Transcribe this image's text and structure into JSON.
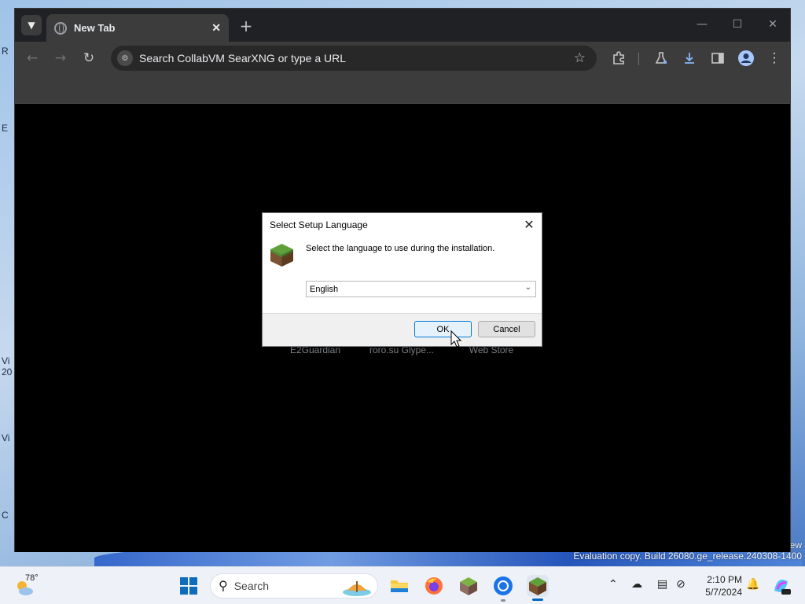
{
  "desktop": {
    "fragments": [
      "R",
      "E",
      "Vi",
      "20",
      "Vi",
      "C"
    ],
    "eval_line1": "ew",
    "eval_text": "Evaluation copy. Build 26080.ge_release.240308-1400"
  },
  "browser": {
    "tab_title": "New Tab",
    "omnibox_placeholder": "Search CollabVM SearXNG or type a URL",
    "shortcuts": [
      "E2Guardian",
      "roro.su Glype...",
      "Web Store"
    ]
  },
  "dialog": {
    "title": "Select Setup Language",
    "message": "Select the language to use during the installation.",
    "selected_language": "English",
    "ok_label": "OK",
    "cancel_label": "Cancel"
  },
  "taskbar": {
    "weather_temp": "78°",
    "search_label": "Search",
    "time": "2:10 PM",
    "date": "5/7/2024"
  },
  "colors": {
    "accent": "#0078d4",
    "browser_dark": "#202124",
    "toolbar": "#3c3c3c"
  }
}
